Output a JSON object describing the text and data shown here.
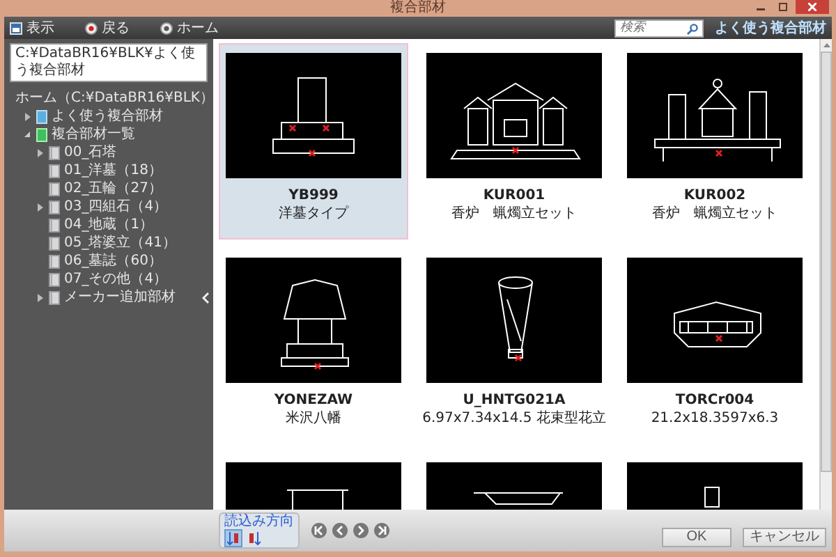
{
  "window": {
    "title": "複合部材"
  },
  "toolbar": {
    "items": [
      {
        "kind": "view",
        "label": "表示"
      },
      {
        "kind": "back",
        "label": "戻る"
      },
      {
        "kind": "home",
        "label": "ホーム"
      }
    ],
    "search": {
      "placeholder": "検索"
    },
    "favorites_button": "よく使う複合部材"
  },
  "sidebar": {
    "path": "C:¥DataBR16¥BLK¥よく使う複合部材",
    "tree": [
      {
        "label": "ホーム（C:¥DataBR16¥BLK）",
        "kind": "home",
        "children": [
          {
            "label": "よく使う複合部材",
            "kind": "favorite",
            "expanded": false
          },
          {
            "label": "複合部材一覧",
            "kind": "list",
            "expanded": true,
            "children": [
              {
                "label": "00_石塔",
                "kind": "folder",
                "expanded": false
              },
              {
                "label": "01_洋墓（18）",
                "kind": "folder"
              },
              {
                "label": "02_五輪（27）",
                "kind": "folder"
              },
              {
                "label": "03_四組石（4）",
                "kind": "folder",
                "expanded": false
              },
              {
                "label": "04_地蔵（1）",
                "kind": "folder"
              },
              {
                "label": "05_塔婆立（41）",
                "kind": "folder"
              },
              {
                "label": "06_墓誌（60）",
                "kind": "folder"
              },
              {
                "label": "07_その他（4）",
                "kind": "folder"
              },
              {
                "label": "メーカー追加部材",
                "kind": "folder",
                "expanded": false
              }
            ]
          }
        ]
      }
    ]
  },
  "gallery": {
    "items": [
      {
        "code": "YB999",
        "name": "洋墓タイプ",
        "selected": true
      },
      {
        "code": "KUR001",
        "name": "香炉　蝋燭立セット",
        "selected": false
      },
      {
        "code": "KUR002",
        "name": "香炉　蝋燭立セット",
        "selected": false
      },
      {
        "code": "YONEZAW",
        "name": "米沢八幡",
        "selected": false
      },
      {
        "code": "U_HNTG021A",
        "name": "6.97x7.34x14.5 花束型花立",
        "selected": false
      },
      {
        "code": "TORCr004",
        "name": "21.2x18.3597x6.3",
        "selected": false
      },
      {
        "selected": false
      },
      {
        "selected": false
      },
      {
        "selected": false
      }
    ]
  },
  "footer": {
    "direction_label": "読込み方向",
    "directions": [
      {
        "selected": true
      },
      {
        "selected": false
      }
    ],
    "nav": [
      {
        "kind": "first"
      },
      {
        "kind": "prev"
      },
      {
        "kind": "next"
      },
      {
        "kind": "last"
      }
    ],
    "ok": "OK",
    "cancel": "キャンセル"
  }
}
